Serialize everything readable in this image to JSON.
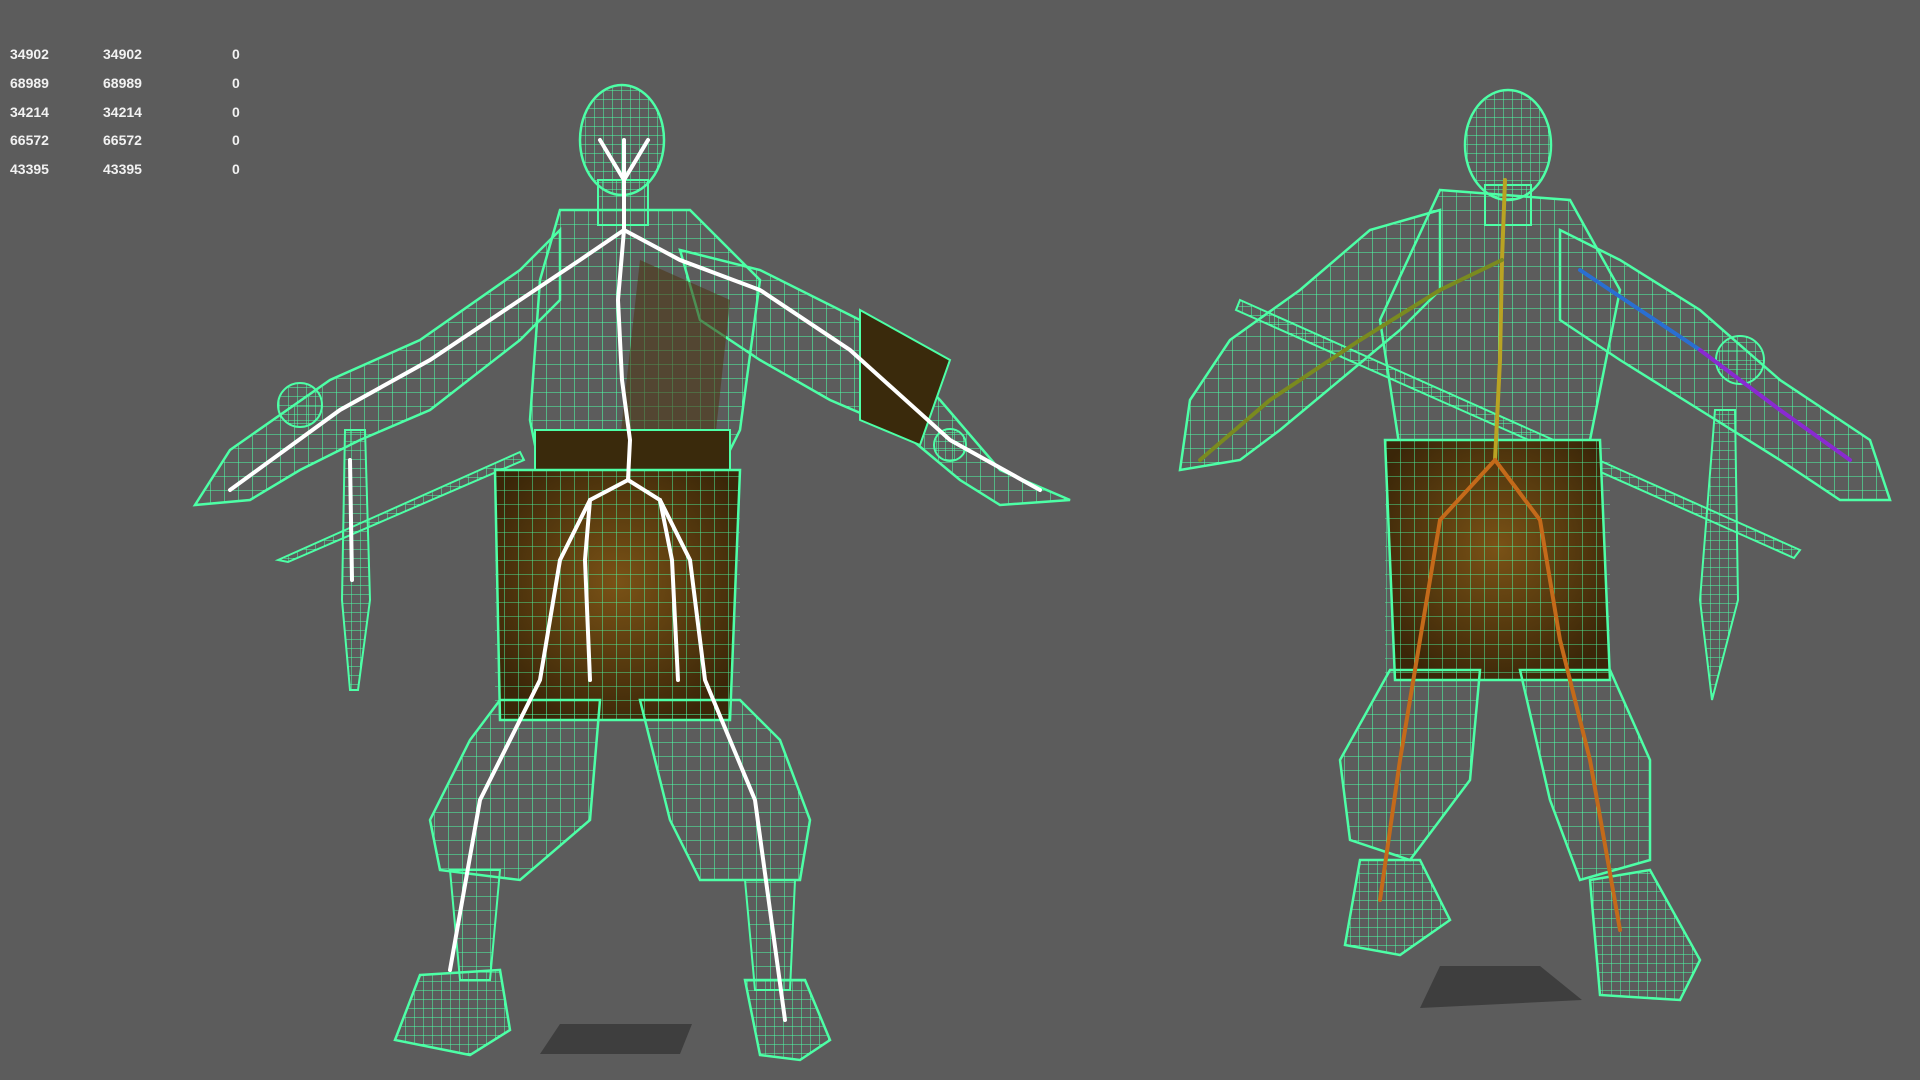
{
  "viewport": {
    "background_color": "#5c5c5c",
    "wireframe_color": "#4dffa6",
    "skeleton_color": "#ffffff",
    "cloth_color": "#5a3a12"
  },
  "heads_up_display": {
    "rows": [
      {
        "a": "34902",
        "b": "34902",
        "c": "0"
      },
      {
        "a": "68989",
        "b": "68989",
        "c": "0"
      },
      {
        "a": "34214",
        "b": "34214",
        "c": "0"
      },
      {
        "a": "66572",
        "b": "66572",
        "c": "0"
      },
      {
        "a": "43395",
        "b": "43395",
        "c": "0"
      }
    ]
  }
}
